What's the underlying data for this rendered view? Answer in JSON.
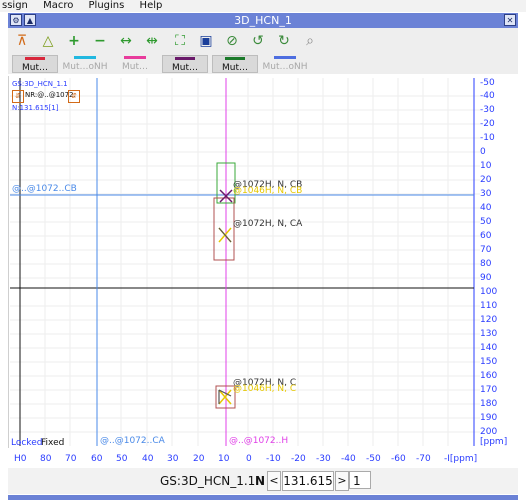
{
  "menubar": {
    "items": [
      "ssign",
      "Macro",
      "Plugins",
      "Help"
    ]
  },
  "window": {
    "title": "3D_HCN_1"
  },
  "toolbar": {
    "icons": [
      "peak-pick-icon",
      "integrate-icon",
      "add-icon",
      "remove-icon",
      "expand-h-icon",
      "compress-h-icon",
      "fit-icon",
      "save-icon",
      "zoom-reset-icon",
      "undo-zoom-icon",
      "redo-zoom-icon",
      "zoom-icon"
    ],
    "mutations": [
      {
        "label": "Mut…ANH",
        "color": "#d8283c",
        "active": true
      },
      {
        "label": "Mut…oNH",
        "color": "#22b8e0",
        "active": false
      },
      {
        "label": "Mut…ONH",
        "color": "#e83c9c",
        "active": false
      },
      {
        "label": "Mut…aNH",
        "color": "#6a1a6a",
        "active": true
      },
      {
        "label": "Mut…aNH",
        "color": "#1b7a2a",
        "active": true
      },
      {
        "label": "Mut…oNH",
        "color": "#4e6ee0",
        "active": false
      }
    ]
  },
  "plot": {
    "header_label": "GS:3D_HCN_1.1",
    "nr_label": "NR:@..@1072.",
    "n_label": "N:131.615[1]",
    "left_line_label": "@..@1072..CB",
    "bottom_left_label": "@..@1072..CA",
    "bottom_mid_label": "@..@1072..H",
    "locked_label": "Locked",
    "fixed_label": "Fixed",
    "y_unit": "[ppm]",
    "y_ticks": [
      "-50",
      "-40",
      "-30",
      "-20",
      "-10",
      "0",
      "10",
      "20",
      "30",
      "40",
      "50",
      "60",
      "70",
      "80",
      "90",
      "100",
      "110",
      "120",
      "130",
      "140",
      "150",
      "160",
      "170",
      "180",
      "190",
      "200"
    ],
    "x_ticks": [
      "H0",
      "80",
      "70",
      "60",
      "50",
      "40",
      "30",
      "20",
      "10",
      "0",
      "-10",
      "-20",
      "-30",
      "-40",
      "-50",
      "-60",
      "-70",
      "-I[ppm]"
    ],
    "peaks": [
      {
        "label": "@1072H, N, CB",
        "ghost": "@1046H, N, CB"
      },
      {
        "label": "@1072H, N, CA",
        "ghost": ""
      },
      {
        "label": "@1072H, N, C",
        "ghost": "@1046H, N, C"
      }
    ]
  },
  "bottombar": {
    "spectrum_label": "GS:3D_HCN_1.1",
    "dim_label": "N",
    "prev_label": "<",
    "value": "131.615",
    "next_label": ">",
    "plane": "1"
  }
}
